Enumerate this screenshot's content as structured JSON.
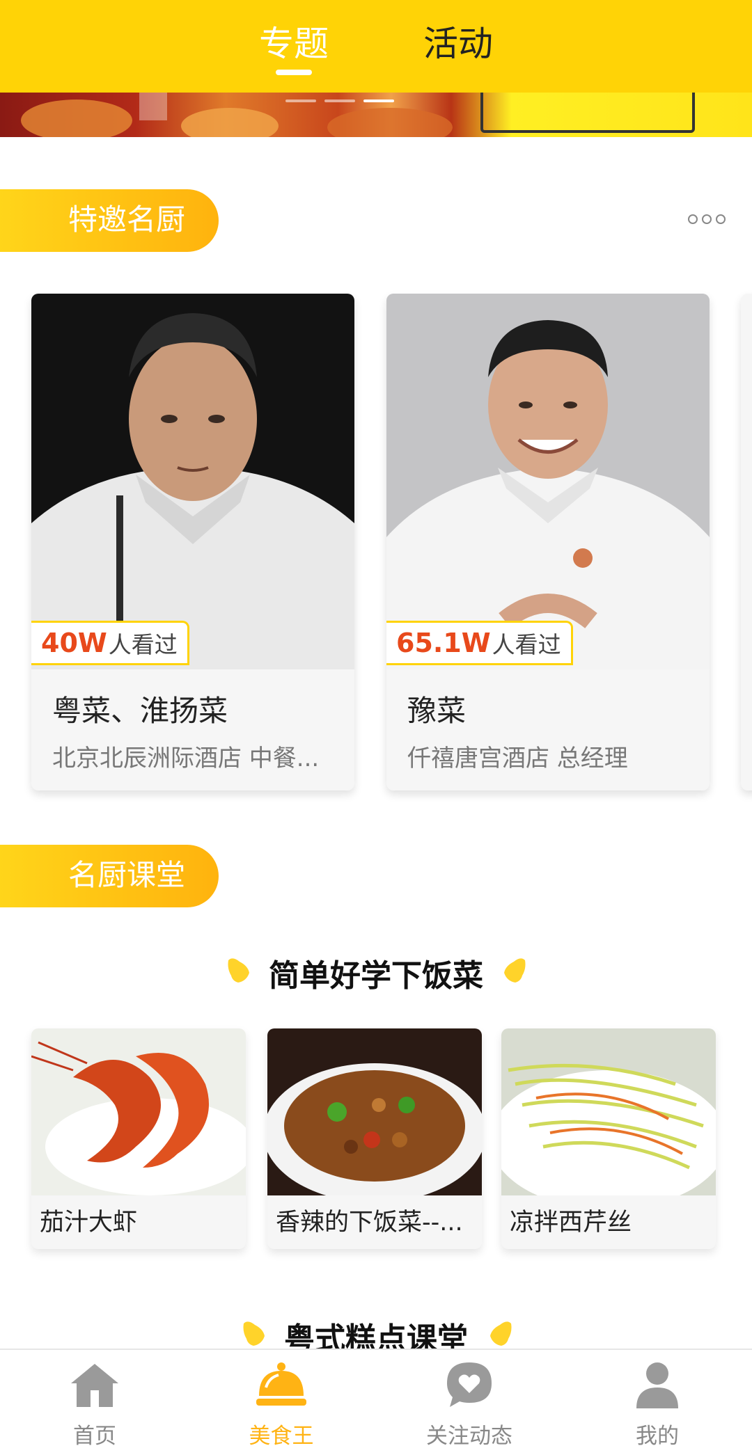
{
  "header": {
    "tabs": [
      {
        "label": "专题",
        "active": true
      },
      {
        "label": "活动",
        "active": false
      }
    ],
    "background_color": "#FFD306"
  },
  "banner": {
    "image": "food-promo-banner",
    "dot_count": 3,
    "active_dot": 2
  },
  "chefs_section": {
    "title": "特邀名厨",
    "more_icon": "more-dots-icon",
    "chefs": [
      {
        "photo": "chef-portrait-1",
        "views_number": "40W",
        "views_suffix": "人看过",
        "cuisine": "粤菜、淮扬菜",
        "hotel": "北京北辰洲际酒店 中餐..."
      },
      {
        "photo": "chef-portrait-2",
        "views_number": "65.1W",
        "views_suffix": "人看过",
        "cuisine": "豫菜",
        "hotel": "仟禧唐宫酒店 总经理"
      }
    ]
  },
  "classroom_section": {
    "title": "名厨课堂",
    "lesson_groups": [
      {
        "heading": "简单好学下饭菜",
        "recipes": [
          {
            "photo": "braised-prawns-photo",
            "title": "茄汁大虾"
          },
          {
            "photo": "spicy-stir-fry-photo",
            "title": "香辣的下饭菜--..."
          },
          {
            "photo": "celery-salad-photo",
            "title": "凉拌西芹丝"
          }
        ]
      },
      {
        "heading": "粤式糕点课堂"
      }
    ]
  },
  "bottom_nav": {
    "items": [
      {
        "label": "首页",
        "icon": "home-icon",
        "active": false
      },
      {
        "label": "美食王",
        "icon": "food-cloche-icon",
        "active": true
      },
      {
        "label": "关注动态",
        "icon": "heart-chat-icon",
        "active": false
      },
      {
        "label": "我的",
        "icon": "profile-icon",
        "active": false
      }
    ],
    "active_color": "#FFB314",
    "inactive_color": "#888888"
  }
}
